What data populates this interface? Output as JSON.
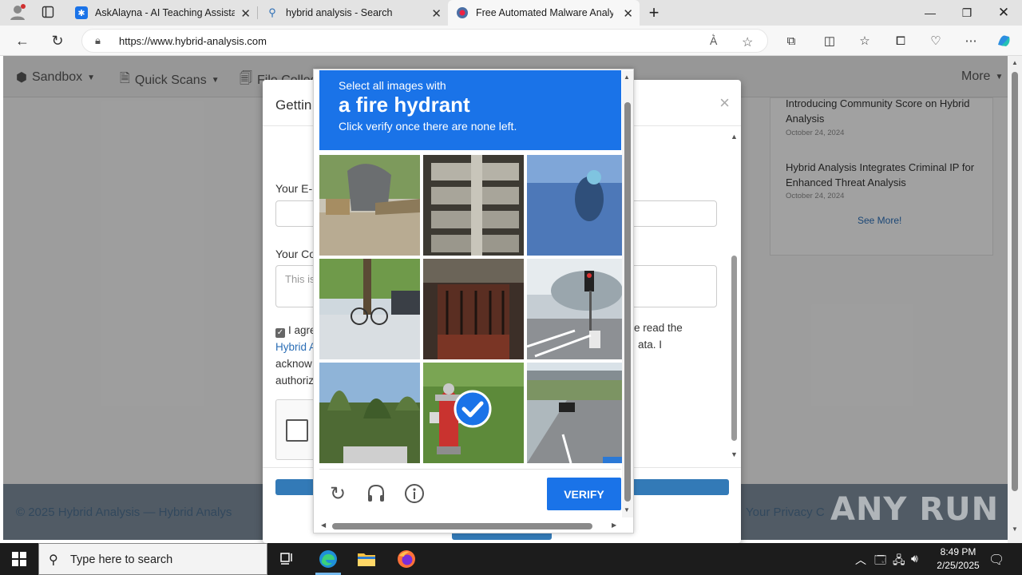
{
  "browser": {
    "tabs": [
      {
        "label": "AskAlayna - AI Teaching Assistan",
        "icon": "gear-icon"
      },
      {
        "label": "hybrid analysis - Search",
        "icon": "search-icon"
      },
      {
        "label": "Free Automated Malware Analysi",
        "icon": "hybrid-icon"
      }
    ],
    "new_tab": "+",
    "url": "https://www.hybrid-analysis.com"
  },
  "page": {
    "nav": {
      "sandbox": "Sandbox",
      "quick_scans": "Quick Scans",
      "file_collections": "File Collec",
      "more": "More"
    },
    "news": [
      {
        "title": "Introducing Community Score on Hybrid Analysis",
        "date": "October 24, 2024"
      },
      {
        "title": "Hybrid Analysis Integrates Criminal IP for Enhanced Threat Analysis",
        "date": "October 24, 2024"
      }
    ],
    "see_more": "See More!",
    "footer_left": "© 2025 Hybrid Analysis — Hybrid Analys",
    "footer_right": "Your Privacy C"
  },
  "modal": {
    "title": "Gettin",
    "close": "×",
    "email_label": "Your E-M",
    "comment_label": "Your Co",
    "comment_placeholder": "This is",
    "agree_line1": "I agre",
    "agree_link": "Hybrid A",
    "agree_line3": "acknow",
    "agree_line4": "authoriz",
    "agree_right1": "e read the",
    "agree_right2": "ata. I"
  },
  "captcha": {
    "instruction_top": "Select all images with",
    "target": "a fire hydrant",
    "instruction_bottom": "Click verify once there are none left.",
    "verify_label": "VERIFY",
    "selected_tile": 7
  },
  "watermark": "ANY RUN",
  "taskbar": {
    "search_placeholder": "Type here to search",
    "time": "8:49 PM",
    "date": "2/25/2025"
  },
  "colors": {
    "accent": "#1a73e8",
    "footer": "#1e3a55",
    "link": "#2a6db5"
  }
}
